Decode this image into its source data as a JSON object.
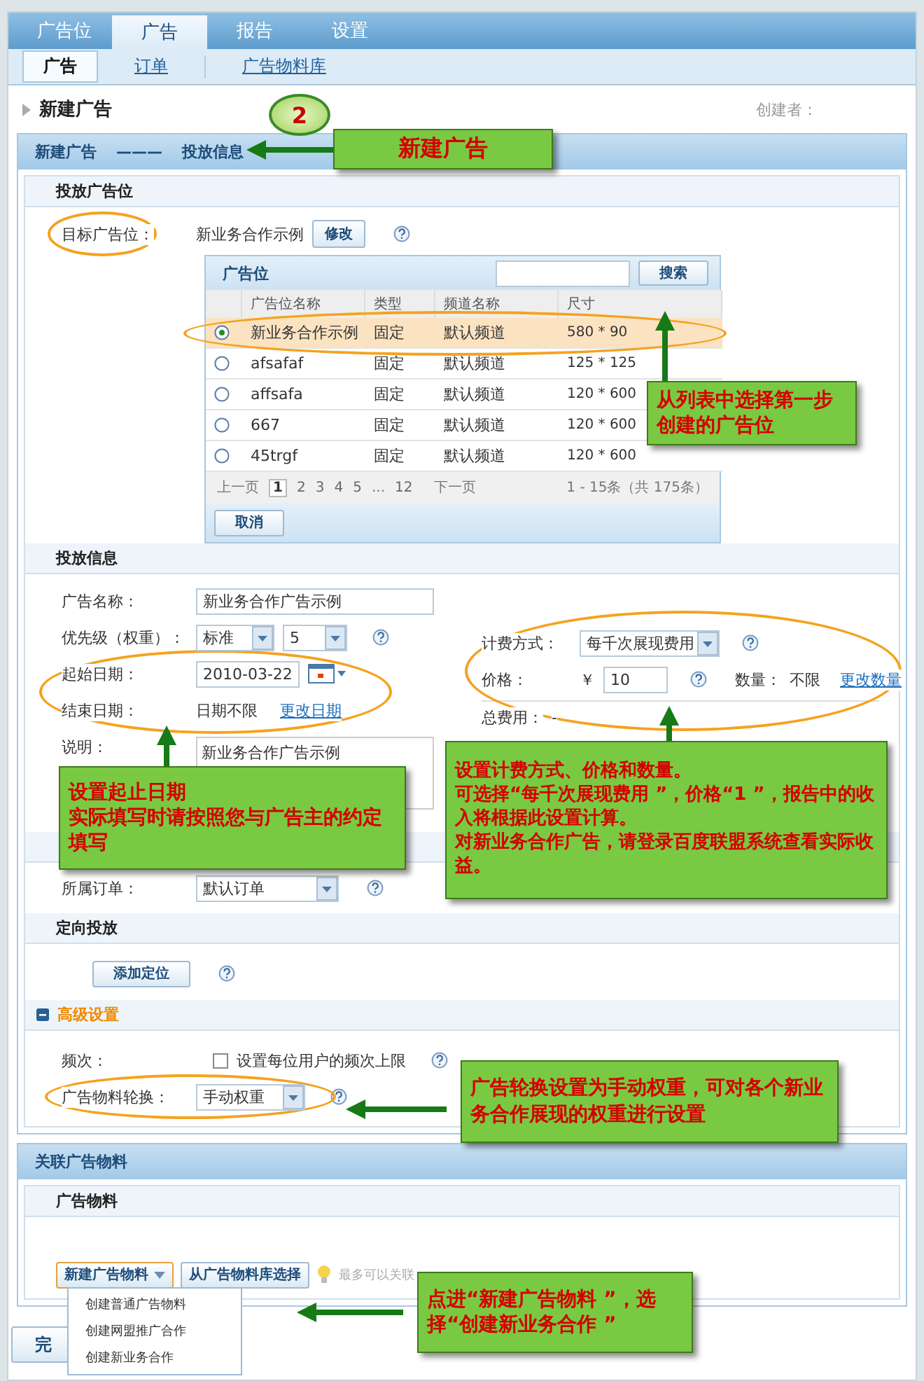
{
  "nav_tabs": [
    {
      "label": "广告位",
      "selected": false
    },
    {
      "label": "广告",
      "selected": true
    },
    {
      "label": "报告",
      "selected": false
    },
    {
      "label": "设置",
      "selected": false
    }
  ],
  "sub_nav": [
    {
      "label": "广告",
      "selected": true
    },
    {
      "label": "订单",
      "selected": false
    },
    {
      "label": "广告物料库",
      "selected": false
    }
  ],
  "page_title": "新建广告",
  "creator_label": "创建者：",
  "step_bar": {
    "step": "新建广告",
    "separator": "———",
    "current": "投放信息"
  },
  "placement": {
    "title": "投放广告位",
    "label": "目标广告位：",
    "value": "新业务合作示例",
    "button": "修改"
  },
  "picker": {
    "title": "广告位",
    "search_button": "搜索",
    "columns": [
      "广告位名称",
      "类型",
      "频道名称",
      "尺寸"
    ],
    "rows": [
      {
        "name": "新业务合作示例",
        "type": "固定",
        "channel": "默认频道",
        "size": "580 * 90",
        "selected": true
      },
      {
        "name": "afsafaf",
        "type": "固定",
        "channel": "默认频道",
        "size": "125 * 125",
        "selected": false
      },
      {
        "name": "affsafa",
        "type": "固定",
        "channel": "默认频道",
        "size": "120 * 600",
        "selected": false
      },
      {
        "name": "667",
        "type": "固定",
        "channel": "默认频道",
        "size": "120 * 600",
        "selected": false
      },
      {
        "name": "45trgf",
        "type": "固定",
        "channel": "默认频道",
        "size": "120 * 600",
        "selected": false
      }
    ],
    "prev": "上一页",
    "pages": [
      {
        "label": "1",
        "selected": true
      },
      {
        "label": "2",
        "selected": false
      },
      {
        "label": "3",
        "selected": false
      },
      {
        "label": "4",
        "selected": false
      },
      {
        "label": "5",
        "selected": false
      }
    ],
    "ellipsis": "...",
    "last_page": "12",
    "next": "下一页",
    "summary": "1 - 15条（共 175条）",
    "cancel": "取消"
  },
  "delivery": {
    "title": "投放信息",
    "name_label": "广告名称：",
    "name_value": "新业务合作广告示例",
    "priority_label": "优先级（权重）：",
    "priority_level": "标准",
    "priority_value": "5",
    "start_label": "起始日期：",
    "start_value": "2010-03-22",
    "end_label": "结束日期：",
    "end_value": "日期不限",
    "end_link": "更改日期",
    "desc_label": "说明：",
    "desc_value": "新业务合作广告示例",
    "billing_label": "计费方式：",
    "billing_value": "每千次展现费用",
    "price_label": "价格：",
    "currency": "￥",
    "price_value": "10",
    "quantity_label": "数量：",
    "quantity_value": "不限",
    "quantity_link": "更改数量",
    "total_label": "总费用：",
    "total_value": "-"
  },
  "order": {
    "label": "所属订单：",
    "value": "默认订单"
  },
  "targeting": {
    "title": "定向投放",
    "button": "添加定位"
  },
  "advanced": {
    "title": "高级设置",
    "expanded": true,
    "frequency_label": "频次：",
    "frequency_option": "设置每位用户的频次上限",
    "frequency_checked": false,
    "rotation_label": "广告物料轮换：",
    "rotation_value": "手动权重"
  },
  "creatives": {
    "bar_title": "关联广告物料",
    "title": "广告物料",
    "new_button": "新建广告物料",
    "library_button": "从广告物料库选择",
    "hint": "最多可以关联",
    "menu": [
      "创建普通广告物料",
      "创建网盟推广合作",
      "创建新业务合作"
    ]
  },
  "finish_button": "完",
  "step_badge": "2",
  "callouts": [
    "新建广告",
    "从列表中选择第一步创建的广告位",
    "设置起止日期",
    "实际填写时请按照您与广告主的约定填写",
    "设置计费方式、价格和数量。",
    "可选择“每千次展现费用 ”，价格“1 ”，报告中的收入将根据此设置计算。",
    "对新业务合作广告，请登录百度联盟系统查看实际收益。",
    "广告轮换设置为手动权重，可对各个新业务合作展现的权重进行设置",
    "点进“新建广告物料 ”，选择“创建新业务合作 ”"
  ]
}
